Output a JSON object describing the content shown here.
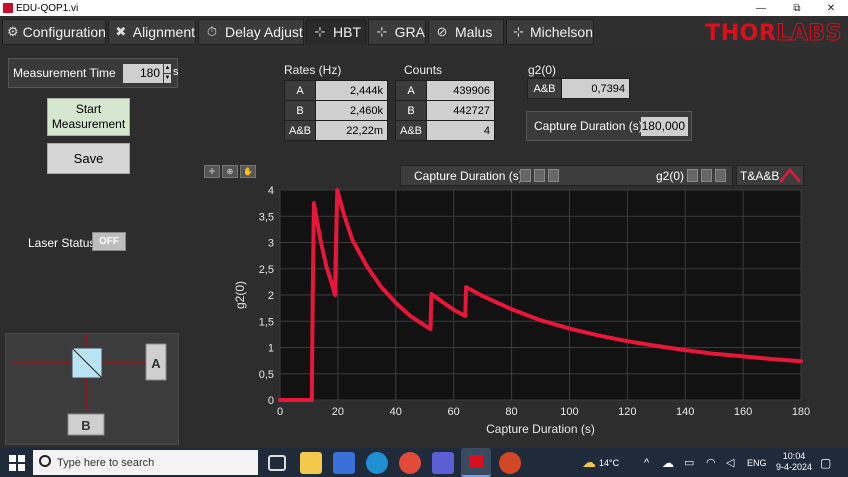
{
  "window": {
    "title": "EDU-QOP1.vi",
    "controls": [
      "—",
      "⧉",
      "✕"
    ]
  },
  "tabs": [
    {
      "label": "Configuration",
      "icon": "gear-icon",
      "glyph": "⚙"
    },
    {
      "label": "Alignment",
      "icon": "wrench-icon",
      "glyph": "✖"
    },
    {
      "label": "Delay Adjust",
      "icon": "stopwatch-icon",
      "glyph": "⏱"
    },
    {
      "label": "HBT",
      "icon": "beamsplitter-icon",
      "glyph": "⊹"
    },
    {
      "label": "GRA",
      "icon": "gra-setup-icon",
      "glyph": "⊹"
    },
    {
      "label": "Malus",
      "icon": "polarizer-icon",
      "glyph": "⊘"
    },
    {
      "label": "Michelson",
      "icon": "interferometer-icon",
      "glyph": "⊹"
    }
  ],
  "active_tab": "HBT",
  "brand": {
    "bold": "THOR",
    "light": "LABS",
    "color": "#d8101e"
  },
  "measurement": {
    "label": "Measurement Time",
    "value": "180",
    "unit": "s",
    "start_label": "Start Measurement",
    "save_label": "Save"
  },
  "laser": {
    "label": "Laser Status",
    "state": "OFF"
  },
  "setup_diagram": {
    "detector_a": "A",
    "detector_b": "B"
  },
  "rates": {
    "title": "Rates (Hz)",
    "rows": [
      {
        "key": "A",
        "value": "2,444k"
      },
      {
        "key": "B",
        "value": "2,460k"
      },
      {
        "key": "A&B",
        "value": "22,22m"
      }
    ]
  },
  "counts": {
    "title": "Counts",
    "rows": [
      {
        "key": "A",
        "value": "439906"
      },
      {
        "key": "B",
        "value": "442727"
      },
      {
        "key": "A&B",
        "value": "4"
      }
    ]
  },
  "g2": {
    "title": "g2(0)",
    "key": "A&B",
    "value": "0,7394"
  },
  "capture": {
    "label": "Capture Duration (s)",
    "value": "180,000"
  },
  "plot_legend": {
    "x_name": "Capture Duration (s)",
    "y_name": "g2(0)",
    "trace_name": "T&A&B",
    "trace_color": "#e8173a"
  },
  "chart_data": {
    "type": "line",
    "xlabel": "Capture Duration (s)",
    "ylabel": "g2(0)",
    "xlim": [
      0,
      180
    ],
    "ylim": [
      0,
      4
    ],
    "x_ticks": [
      "0",
      "20",
      "40",
      "60",
      "80",
      "100",
      "120",
      "140",
      "160",
      "180"
    ],
    "y_ticks": [
      "0",
      "0,5",
      "1",
      "1,5",
      "2",
      "2,5",
      "3",
      "3,5",
      "4"
    ],
    "grid": true,
    "line_color": "#e8173a",
    "series": [
      {
        "name": "T&A&B",
        "points": [
          [
            0,
            0.0
          ],
          [
            11,
            0.0
          ],
          [
            11.3,
            1.9
          ],
          [
            11.7,
            3.75
          ],
          [
            14,
            3.05
          ],
          [
            16,
            2.55
          ],
          [
            18,
            2.2
          ],
          [
            19,
            2.0
          ],
          [
            19.3,
            2.9
          ],
          [
            19.8,
            4.0
          ],
          [
            22,
            3.55
          ],
          [
            25,
            3.05
          ],
          [
            30,
            2.55
          ],
          [
            35,
            2.15
          ],
          [
            40,
            1.85
          ],
          [
            45,
            1.6
          ],
          [
            50,
            1.42
          ],
          [
            52,
            1.35
          ],
          [
            52.3,
            2.02
          ],
          [
            56,
            1.87
          ],
          [
            60,
            1.72
          ],
          [
            64,
            1.6
          ],
          [
            64.3,
            2.15
          ],
          [
            70,
            1.98
          ],
          [
            80,
            1.73
          ],
          [
            90,
            1.52
          ],
          [
            100,
            1.36
          ],
          [
            110,
            1.23
          ],
          [
            120,
            1.12
          ],
          [
            130,
            1.03
          ],
          [
            140,
            0.95
          ],
          [
            150,
            0.88
          ],
          [
            160,
            0.83
          ],
          [
            170,
            0.78
          ],
          [
            180,
            0.74
          ]
        ]
      }
    ]
  },
  "taskbar": {
    "search_placeholder": "Type here to search",
    "weather": "14°C",
    "language": "ENG",
    "time": "10:04",
    "date": "9-4-2024"
  }
}
